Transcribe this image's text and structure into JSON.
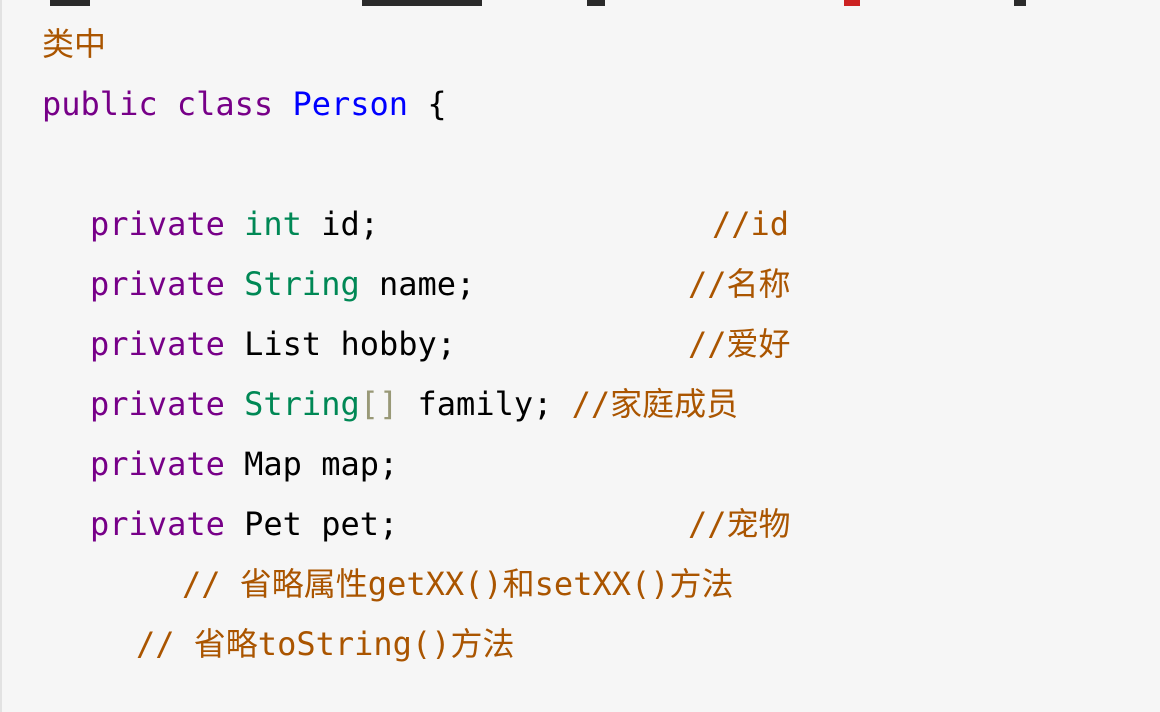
{
  "code": {
    "line1": {
      "text": "类中"
    },
    "line2": {
      "kw": "public class",
      "classname": "Person",
      "brace": "{"
    },
    "line3": {
      "kw": "private",
      "type": "int",
      "var": "id;",
      "comment": "//id"
    },
    "line4": {
      "kw": "private",
      "type": "String",
      "var": "name;",
      "comment": "//名称"
    },
    "line5": {
      "kw": "private",
      "var": "List hobby;",
      "comment": "//爱好"
    },
    "line6": {
      "kw": "private",
      "type": "String",
      "brackets": "[]",
      "var": "family;",
      "comment": "//家庭成员"
    },
    "line7": {
      "kw": "private",
      "var": "Map map;"
    },
    "line8": {
      "kw": "private",
      "var": "Pet pet;",
      "comment": "//宠物"
    },
    "line9": {
      "comment": "// 省略属性getXX()和setXX()方法"
    },
    "line10": {
      "comment": "// 省略toString()方法"
    }
  },
  "colors": {
    "keyword": "#770088",
    "type": "#008855",
    "class_name": "#0000ff",
    "comment": "#aa5500",
    "background": "#f6f6f6"
  }
}
